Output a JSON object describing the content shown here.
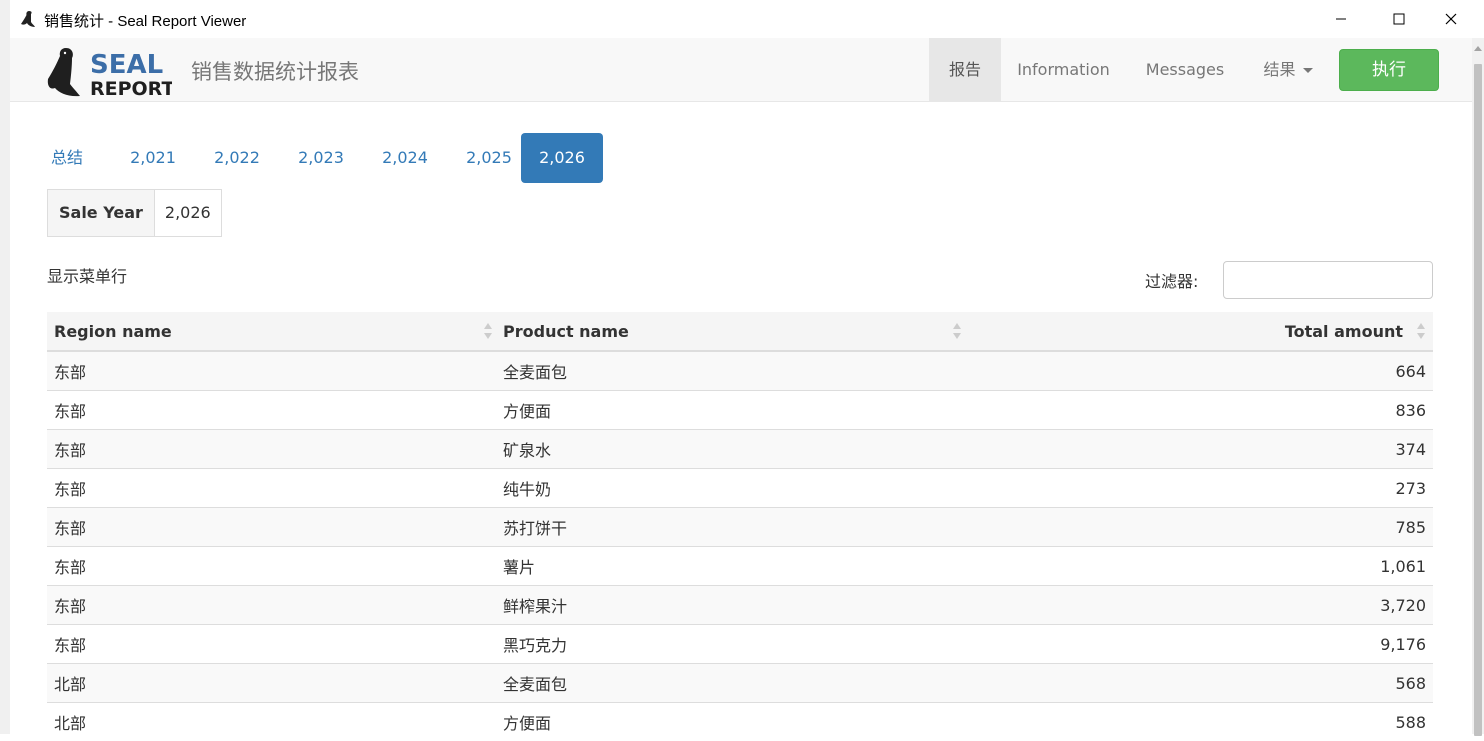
{
  "window": {
    "title": "销售统计 - Seal Report Viewer"
  },
  "navbar": {
    "logo_top": "SEAL",
    "logo_bottom": "REPORT",
    "report_title": "销售数据统计报表",
    "items": [
      {
        "label": "报告",
        "active": true
      },
      {
        "label": "Information"
      },
      {
        "label": "Messages"
      },
      {
        "label": "结果"
      }
    ],
    "execute_label": "执行"
  },
  "tabs": [
    "总结",
    "2,021",
    "2,022",
    "2,023",
    "2,024",
    "2,025",
    "2,026"
  ],
  "active_tab": "2,026",
  "sale_year": {
    "label": "Sale Year",
    "value": "2,026"
  },
  "table_controls": {
    "menu_rows_label": "显示菜单行",
    "filter_label": "过滤器:",
    "filter_value": ""
  },
  "table": {
    "columns": [
      "Region name",
      "Product name",
      "Total amount"
    ],
    "rows": [
      [
        "东部",
        "全麦面包",
        "664"
      ],
      [
        "东部",
        "方便面",
        "836"
      ],
      [
        "东部",
        "矿泉水",
        "374"
      ],
      [
        "东部",
        "纯牛奶",
        "273"
      ],
      [
        "东部",
        "苏打饼干",
        "785"
      ],
      [
        "东部",
        "薯片",
        "1,061"
      ],
      [
        "东部",
        "鲜榨果汁",
        "3,720"
      ],
      [
        "东部",
        "黑巧克力",
        "9,176"
      ],
      [
        "北部",
        "全麦面包",
        "568"
      ],
      [
        "北部",
        "方便面",
        "588"
      ]
    ]
  },
  "colors": {
    "primary": "#337ab7",
    "success": "#5cb85c",
    "logo": "#3c6ea8"
  }
}
